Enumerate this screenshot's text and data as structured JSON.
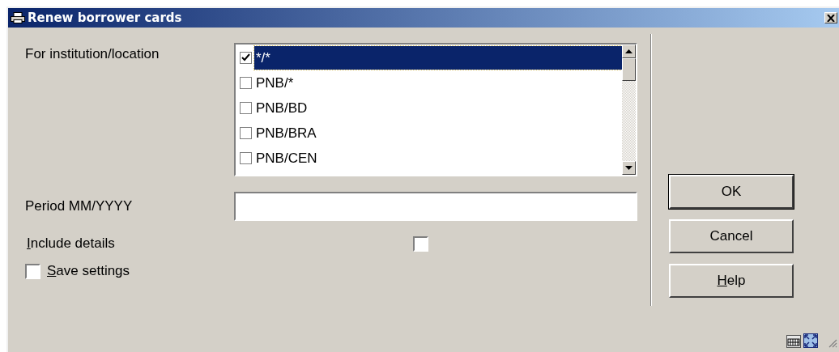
{
  "window": {
    "title": "Renew borrower cards"
  },
  "institution": {
    "label": "For institution/location",
    "items": [
      {
        "label": "*/*",
        "checked": true,
        "selected": true
      },
      {
        "label": "PNB/*",
        "checked": false,
        "selected": false
      },
      {
        "label": "PNB/BD",
        "checked": false,
        "selected": false
      },
      {
        "label": "PNB/BRA",
        "checked": false,
        "selected": false
      },
      {
        "label": "PNB/CEN",
        "checked": false,
        "selected": false
      }
    ]
  },
  "period": {
    "label": "Period MM/YYYY"
  },
  "include_details": {
    "label": "Include details",
    "checked": false
  },
  "save_settings": {
    "label": "Save settings",
    "checked": false
  },
  "buttons": [
    {
      "label": "OK",
      "default": true
    },
    {
      "label": "Cancel",
      "default": false
    },
    {
      "label": "Help",
      "default": false
    }
  ]
}
